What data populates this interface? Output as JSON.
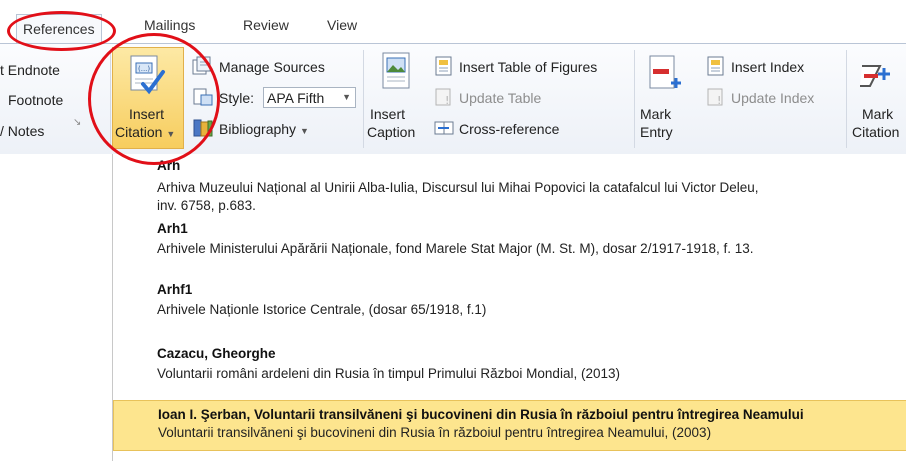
{
  "tabs": [
    "References",
    "Mailings",
    "Review",
    "View"
  ],
  "footnotes": {
    "insert_endnote": "t Endnote",
    "next_footnote": "Footnote",
    "show_notes": "/ Notes"
  },
  "citations": {
    "insert_citation_line1": "Insert",
    "insert_citation_line2": "Citation",
    "manage_sources": "Manage Sources",
    "style_label": "Style:",
    "style_value": "APA Fifth",
    "bibliography": "Bibliography"
  },
  "captions": {
    "insert_caption_line1": "Insert",
    "insert_caption_line2": "Caption",
    "insert_table_of_figures": "Insert Table of Figures",
    "update_table": "Update Table",
    "cross_reference": "Cross-reference"
  },
  "index": {
    "mark_entry_line1": "Mark",
    "mark_entry_line2": "Entry",
    "insert_index": "Insert Index",
    "update_index": "Update Index"
  },
  "table_of_authorities": {
    "mark_citation_line1": "Mark",
    "mark_citation_line2": "Citation"
  },
  "sources": [
    {
      "title": "Arh",
      "detail_line1": "Arhiva Muzeului Național al Unirii Alba-Iulia, Discursul lui Mihai Popovici la catafalcul lui Victor Deleu,",
      "detail_line2": "inv. 6758, p.683."
    },
    {
      "title": "Arh1",
      "detail_line1": "Arhivele Ministerului Apărării Naționale, fond Marele Stat Major (M. St. M), dosar 2/1917-1918, f. 13."
    },
    {
      "title": "Arhf1",
      "detail_line1": "Arhivele Naționle Istorice Centrale, (dosar 65/1918, f.1)"
    },
    {
      "title": "Cazacu, Gheorghe",
      "detail_line1": "Voluntarii români ardeleni din Rusia în timpul Primului Război Mondial, (2013)"
    },
    {
      "title": "Ioan I. Şerban, Voluntarii transilvăneni şi bucovineni din Rusia în războiul pentru întregirea Neamului",
      "detail_line1": "Voluntarii transilvăneni şi bucovineni din Rusia în războiul pentru întregirea Neamului, (2003)",
      "selected": true
    }
  ],
  "colors": {
    "annotation_circle": "#e10f18",
    "highlight": "#fde58e",
    "button_active": "#f9d56e"
  }
}
